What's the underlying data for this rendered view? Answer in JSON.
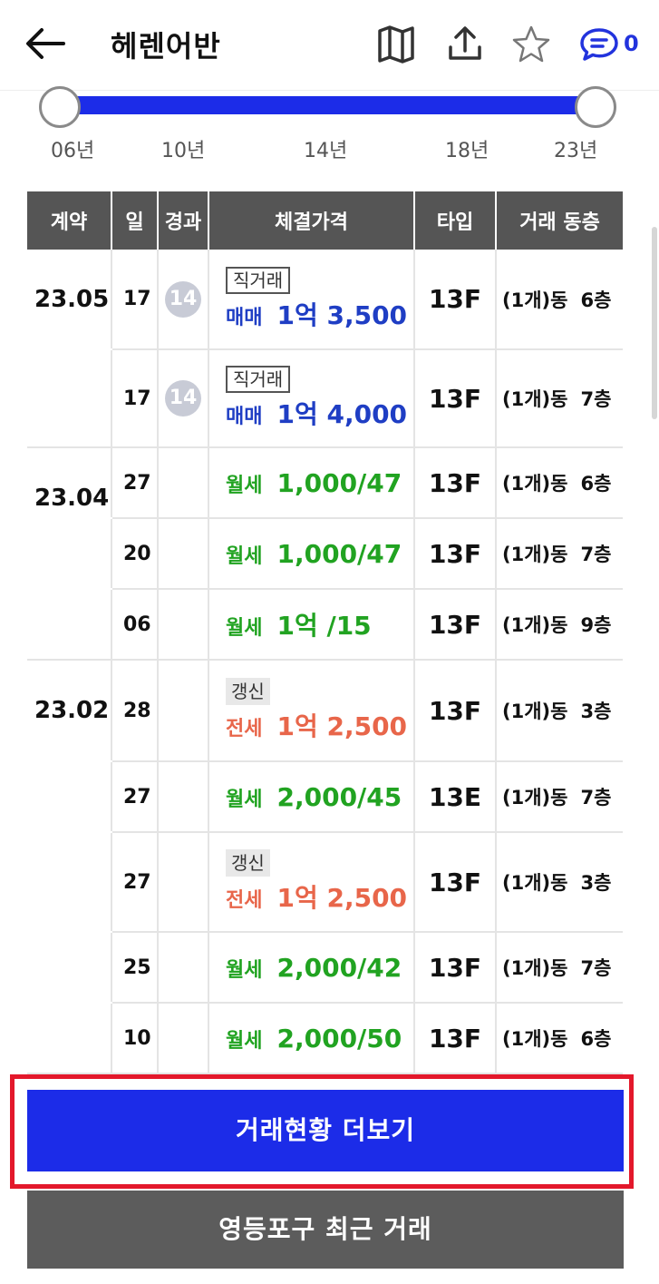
{
  "header": {
    "title": "헤렌어반",
    "chat_count": "0",
    "icons": {
      "back": "back-arrow-icon",
      "map": "map-icon",
      "share": "share-icon",
      "star": "star-icon",
      "chat": "chat-icon"
    }
  },
  "year_slider": {
    "labels": [
      "06년",
      "10년",
      "14년",
      "18년",
      "23년"
    ],
    "selected_start": "06년",
    "selected_end": "23년"
  },
  "table": {
    "headers": [
      "계약",
      "일",
      "경과",
      "체결가격",
      "타입",
      "거래 동층"
    ],
    "rows": [
      {
        "month": "23.05",
        "day": "17",
        "elapsed": "14",
        "tag": "직거래",
        "kind": "매매",
        "price": "1억 3,500",
        "type": "13F",
        "dong": "(1개)동",
        "floor": "6층"
      },
      {
        "month": "",
        "day": "17",
        "elapsed": "14",
        "tag": "직거래",
        "kind": "매매",
        "price": "1억 4,000",
        "type": "13F",
        "dong": "(1개)동",
        "floor": "7층"
      },
      {
        "month": "23.04",
        "day": "27",
        "elapsed": "",
        "tag": "",
        "kind": "월세",
        "price": "1,000/47",
        "type": "13F",
        "dong": "(1개)동",
        "floor": "6층"
      },
      {
        "month": "",
        "day": "20",
        "elapsed": "",
        "tag": "",
        "kind": "월세",
        "price": "1,000/47",
        "type": "13F",
        "dong": "(1개)동",
        "floor": "7층"
      },
      {
        "month": "",
        "day": "06",
        "elapsed": "",
        "tag": "",
        "kind": "월세",
        "price": "1억 /15",
        "type": "13F",
        "dong": "(1개)동",
        "floor": "9층"
      },
      {
        "month": "23.02",
        "day": "28",
        "elapsed": "",
        "tag": "갱신",
        "kind": "전세",
        "price": "1억 2,500",
        "type": "13F",
        "dong": "(1개)동",
        "floor": "3층"
      },
      {
        "month": "",
        "day": "27",
        "elapsed": "",
        "tag": "",
        "kind": "월세",
        "price": "2,000/45",
        "type": "13E",
        "dong": "(1개)동",
        "floor": "7층"
      },
      {
        "month": "",
        "day": "27",
        "elapsed": "",
        "tag": "갱신",
        "kind": "전세",
        "price": "1억 2,500",
        "type": "13F",
        "dong": "(1개)동",
        "floor": "3층"
      },
      {
        "month": "",
        "day": "25",
        "elapsed": "",
        "tag": "",
        "kind": "월세",
        "price": "2,000/42",
        "type": "13F",
        "dong": "(1개)동",
        "floor": "7층"
      },
      {
        "month": "",
        "day": "10",
        "elapsed": "",
        "tag": "",
        "kind": "월세",
        "price": "2,000/50",
        "type": "13F",
        "dong": "(1개)동",
        "floor": "6층"
      }
    ]
  },
  "buttons": {
    "more": "거래현황 더보기",
    "recent": "영등포구 최근 거래"
  },
  "colors": {
    "accent_blue": "#1c2ce8",
    "sale": "#1f3ec4",
    "monthly_rent": "#21a321",
    "jeonse": "#e8664a",
    "highlight_frame": "#e3182b",
    "header_bg": "#555555"
  }
}
